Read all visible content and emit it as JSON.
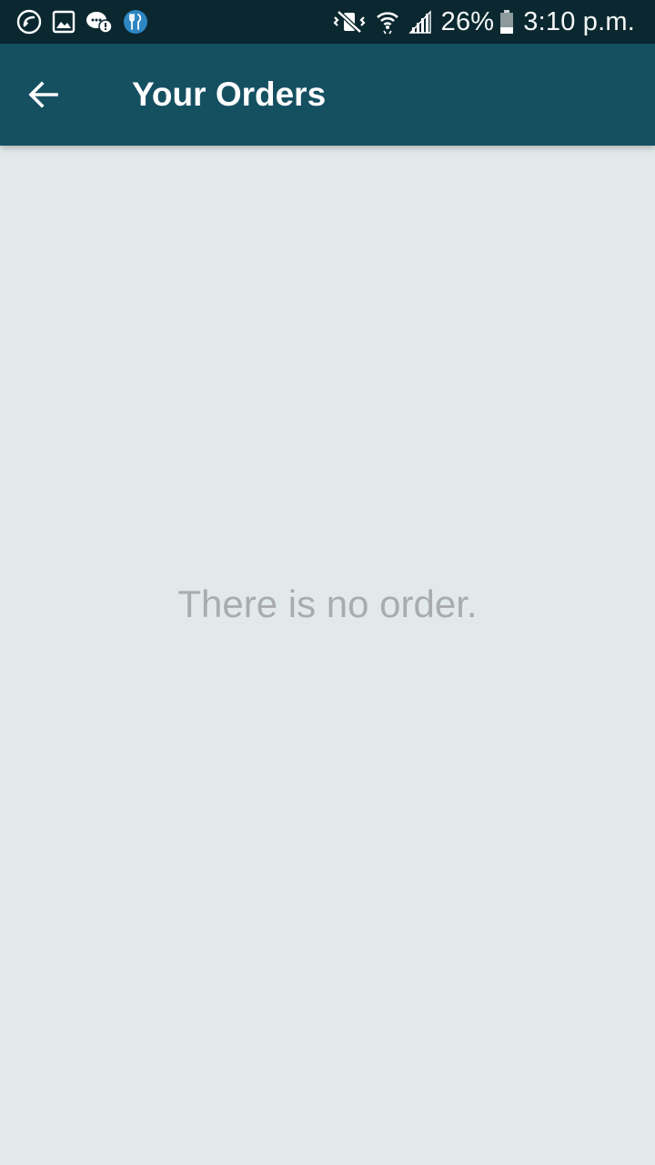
{
  "status_bar": {
    "left_icons": [
      "missed-call-icon",
      "image-icon",
      "chat-alert-icon",
      "restaurant-app-icon"
    ],
    "right_icons": [
      "vibrate-mute-icon",
      "wifi-icon",
      "signal-icon",
      "battery-icon"
    ],
    "battery_percent": "26%",
    "time": "3:10 p.m.",
    "colors": {
      "background": "#0b2830",
      "app_icon": "#2e87c2"
    }
  },
  "app_bar": {
    "title": "Your Orders",
    "back_icon": "arrow-left-icon",
    "colors": {
      "background": "#155061",
      "text": "#ffffff"
    }
  },
  "main": {
    "empty_message": "There is no order.",
    "colors": {
      "background": "#e2e9eb",
      "message": "#a9acad"
    }
  }
}
